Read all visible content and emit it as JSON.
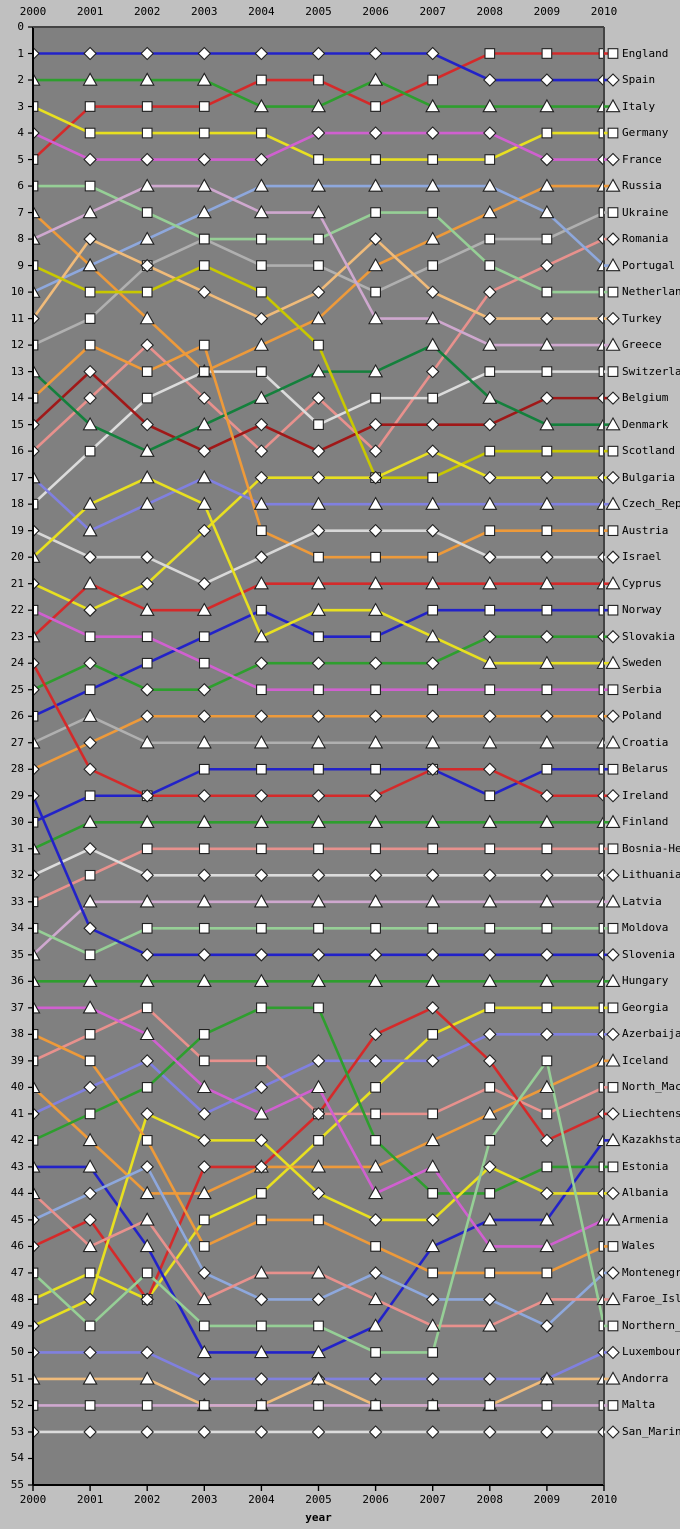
{
  "figure": {
    "background_color": "#c0c0c0",
    "plot_background_color": "#808080",
    "axis_color": "#000000"
  },
  "axes": {
    "x_title": "year",
    "x_ticks": [
      "2000",
      "2001",
      "2002",
      "2003",
      "2004",
      "2005",
      "2006",
      "2007",
      "2008",
      "2009",
      "2010"
    ],
    "x_ticks_top": [
      "2000",
      "2001",
      "2002",
      "2003",
      "2004",
      "2005",
      "2006",
      "2007",
      "2008",
      "2009",
      "2010"
    ],
    "y_ticks": [
      "0",
      "1",
      "2",
      "3",
      "4",
      "5",
      "6",
      "7",
      "8",
      "9",
      "10",
      "11",
      "12",
      "13",
      "14",
      "15",
      "16",
      "17",
      "18",
      "19",
      "20",
      "21",
      "22",
      "23",
      "24",
      "25",
      "26",
      "27",
      "28",
      "29",
      "30",
      "31",
      "32",
      "33",
      "34",
      "35",
      "36",
      "37",
      "38",
      "39",
      "40",
      "41",
      "42",
      "43",
      "44",
      "45",
      "46",
      "47",
      "48",
      "49",
      "50",
      "51",
      "52",
      "53",
      "54",
      "55"
    ]
  },
  "chart_data": {
    "type": "line",
    "subtype": "bump-chart",
    "title": "",
    "xlabel": "year",
    "ylabel": "",
    "x": [
      2000,
      2001,
      2002,
      2003,
      2004,
      2005,
      2006,
      2007,
      2008,
      2009,
      2010
    ],
    "ylim": [
      55,
      0
    ],
    "y_inverted": true,
    "xlim": [
      2000,
      2010
    ],
    "grid": false,
    "legend_position": "right",
    "series": [
      {
        "name": "England",
        "color": "#d42a2a",
        "marker": "square",
        "values": [
          5,
          3,
          3,
          3,
          2,
          2,
          3,
          2,
          1,
          1,
          1
        ]
      },
      {
        "name": "Spain",
        "color": "#2222c8",
        "marker": "diamond",
        "values": [
          1,
          1,
          1,
          1,
          1,
          1,
          1,
          1,
          2,
          2,
          2
        ]
      },
      {
        "name": "Italy",
        "color": "#2e9e2e",
        "marker": "triangle",
        "values": [
          2,
          2,
          2,
          2,
          3,
          3,
          2,
          3,
          3,
          3,
          3
        ]
      },
      {
        "name": "Germany",
        "color": "#e8e020",
        "marker": "square",
        "values": [
          3,
          4,
          4,
          4,
          4,
          5,
          5,
          5,
          5,
          4,
          4
        ]
      },
      {
        "name": "France",
        "color": "#d060d0",
        "marker": "diamond",
        "values": [
          4,
          5,
          5,
          5,
          5,
          4,
          4,
          4,
          4,
          5,
          5
        ]
      },
      {
        "name": "Russia",
        "color": "#ee9a3a",
        "marker": "triangle",
        "values": [
          7,
          9,
          11,
          13,
          12,
          11,
          9,
          8,
          7,
          6,
          6
        ]
      },
      {
        "name": "Ukraine",
        "color": "#b0b0b0",
        "marker": "square",
        "values": [
          12,
          11,
          9,
          8,
          9,
          9,
          10,
          9,
          8,
          8,
          7
        ]
      },
      {
        "name": "Romania",
        "color": "#e8918d",
        "marker": "diamond",
        "values": [
          16,
          14,
          12,
          14,
          16,
          14,
          16,
          13,
          10,
          9,
          8
        ]
      },
      {
        "name": "Portugal",
        "color": "#8ea8dd",
        "marker": "triangle",
        "values": [
          10,
          9,
          8,
          7,
          6,
          6,
          6,
          6,
          6,
          7,
          9
        ]
      },
      {
        "name": "Netherlands",
        "color": "#96cf96",
        "marker": "square",
        "values": [
          6,
          6,
          7,
          8,
          8,
          8,
          7,
          7,
          9,
          10,
          10
        ]
      },
      {
        "name": "Turkey",
        "color": "#f0bb7a",
        "marker": "diamond",
        "values": [
          11,
          8,
          9,
          10,
          11,
          10,
          8,
          10,
          11,
          11,
          11
        ]
      },
      {
        "name": "Greece",
        "color": "#cfa8cf",
        "marker": "triangle",
        "values": [
          8,
          7,
          6,
          6,
          7,
          7,
          11,
          11,
          12,
          12,
          12
        ]
      },
      {
        "name": "Switzerland",
        "color": "#dcdcdc",
        "marker": "square",
        "values": [
          18,
          16,
          14,
          13,
          13,
          15,
          14,
          14,
          13,
          13,
          13
        ]
      },
      {
        "name": "Belgium",
        "color": "#a01818",
        "marker": "diamond",
        "values": [
          15,
          13,
          15,
          16,
          15,
          16,
          15,
          15,
          15,
          14,
          14
        ]
      },
      {
        "name": "Denmark",
        "color": "#14803c",
        "marker": "triangle",
        "values": [
          13,
          15,
          16,
          15,
          14,
          13,
          13,
          12,
          14,
          15,
          15
        ]
      },
      {
        "name": "Scotland",
        "color": "#c8c800",
        "marker": "square",
        "values": [
          9,
          10,
          10,
          9,
          10,
          12,
          17,
          17,
          16,
          16,
          16
        ]
      },
      {
        "name": "Bulgaria",
        "color": "#e8e020",
        "marker": "diamond",
        "values": [
          21,
          22,
          21,
          19,
          17,
          17,
          17,
          16,
          17,
          17,
          17
        ]
      },
      {
        "name": "Czech_Repub",
        "color": "#8080e0",
        "marker": "triangle",
        "values": [
          17,
          19,
          18,
          17,
          18,
          18,
          18,
          18,
          18,
          18,
          18
        ]
      },
      {
        "name": "Austria",
        "color": "#ee9a3a",
        "marker": "square",
        "values": [
          14,
          12,
          13,
          12,
          19,
          20,
          20,
          20,
          19,
          19,
          19
        ]
      },
      {
        "name": "Israel",
        "color": "#d8d8d8",
        "marker": "diamond",
        "values": [
          19,
          20,
          20,
          21,
          20,
          19,
          19,
          19,
          20,
          20,
          20
        ]
      },
      {
        "name": "Cyprus",
        "color": "#d42a2a",
        "marker": "triangle",
        "values": [
          23,
          21,
          22,
          22,
          21,
          21,
          21,
          21,
          21,
          21,
          21
        ]
      },
      {
        "name": "Norway",
        "color": "#2222c8",
        "marker": "square",
        "values": [
          26,
          25,
          24,
          23,
          22,
          23,
          23,
          22,
          22,
          22,
          22
        ]
      },
      {
        "name": "Slovakia",
        "color": "#2e9e2e",
        "marker": "diamond",
        "values": [
          25,
          24,
          25,
          25,
          24,
          24,
          24,
          24,
          23,
          23,
          23
        ]
      },
      {
        "name": "Sweden",
        "color": "#e8e020",
        "marker": "triangle",
        "values": [
          20,
          18,
          17,
          18,
          23,
          22,
          22,
          23,
          24,
          24,
          24
        ]
      },
      {
        "name": "Serbia",
        "color": "#d060d0",
        "marker": "square",
        "values": [
          22,
          23,
          23,
          24,
          25,
          25,
          25,
          25,
          25,
          25,
          25
        ]
      },
      {
        "name": "Poland",
        "color": "#ee9a3a",
        "marker": "diamond",
        "values": [
          28,
          27,
          26,
          26,
          26,
          26,
          26,
          26,
          26,
          26,
          26
        ]
      },
      {
        "name": "Croatia",
        "color": "#b0b0b0",
        "marker": "triangle",
        "values": [
          27,
          26,
          27,
          27,
          27,
          27,
          27,
          27,
          27,
          27,
          27
        ]
      },
      {
        "name": "Belarus",
        "color": "#2222c8",
        "marker": "square",
        "values": [
          30,
          29,
          29,
          28,
          28,
          28,
          28,
          28,
          29,
          28,
          28
        ]
      },
      {
        "name": "Ireland",
        "color": "#d42a2a",
        "marker": "diamond",
        "values": [
          24,
          28,
          29,
          29,
          29,
          29,
          29,
          28,
          28,
          29,
          29
        ]
      },
      {
        "name": "Finland",
        "color": "#2e9e2e",
        "marker": "triangle",
        "values": [
          31,
          30,
          30,
          30,
          30,
          30,
          30,
          30,
          30,
          30,
          30
        ]
      },
      {
        "name": "Bosnia-Herzo",
        "color": "#e8918d",
        "marker": "square",
        "values": [
          33,
          32,
          31,
          31,
          31,
          31,
          31,
          31,
          31,
          31,
          31
        ]
      },
      {
        "name": "Lithuania",
        "color": "#dcdcdc",
        "marker": "diamond",
        "values": [
          32,
          31,
          32,
          32,
          32,
          32,
          32,
          32,
          32,
          32,
          32
        ]
      },
      {
        "name": "Latvia",
        "color": "#cfa8cf",
        "marker": "triangle",
        "values": [
          35,
          33,
          33,
          33,
          33,
          33,
          33,
          33,
          33,
          33,
          33
        ]
      },
      {
        "name": "Moldova",
        "color": "#96cf96",
        "marker": "square",
        "values": [
          34,
          35,
          34,
          34,
          34,
          34,
          34,
          34,
          34,
          34,
          34
        ]
      },
      {
        "name": "Slovenia",
        "color": "#2222c8",
        "marker": "diamond",
        "values": [
          29,
          34,
          35,
          35,
          35,
          35,
          35,
          35,
          35,
          35,
          35
        ]
      },
      {
        "name": "Hungary",
        "color": "#2e9e2e",
        "marker": "triangle",
        "values": [
          36,
          36,
          36,
          36,
          36,
          36,
          36,
          36,
          36,
          36,
          36
        ]
      },
      {
        "name": "Georgia",
        "color": "#e8e020",
        "marker": "square",
        "values": [
          48,
          47,
          48,
          45,
          44,
          42,
          40,
          38,
          37,
          37,
          37
        ]
      },
      {
        "name": "Azerbaijan",
        "color": "#8080e0",
        "marker": "diamond",
        "values": [
          41,
          40,
          39,
          41,
          40,
          39,
          39,
          39,
          38,
          38,
          38
        ]
      },
      {
        "name": "Iceland",
        "color": "#ee9a3a",
        "marker": "triangle",
        "values": [
          40,
          42,
          44,
          44,
          43,
          43,
          43,
          42,
          41,
          40,
          39
        ]
      },
      {
        "name": "North_Macedo",
        "color": "#e8918d",
        "marker": "square",
        "values": [
          39,
          38,
          37,
          39,
          39,
          41,
          41,
          41,
          40,
          41,
          40
        ]
      },
      {
        "name": "Liechtenstei",
        "color": "#d42a2a",
        "marker": "diamond",
        "values": [
          46,
          45,
          48,
          43,
          43,
          41,
          38,
          37,
          39,
          42,
          41
        ]
      },
      {
        "name": "Kazakhstan",
        "color": "#2222c8",
        "marker": "triangle",
        "values": [
          43,
          43,
          46,
          50,
          50,
          50,
          49,
          46,
          45,
          45,
          42
        ]
      },
      {
        "name": "Estonia",
        "color": "#2e9e2e",
        "marker": "square",
        "values": [
          42,
          41,
          40,
          38,
          37,
          37,
          42,
          44,
          44,
          43,
          43
        ]
      },
      {
        "name": "Albania",
        "color": "#e8e020",
        "marker": "diamond",
        "values": [
          49,
          48,
          41,
          42,
          42,
          44,
          45,
          45,
          43,
          44,
          44
        ]
      },
      {
        "name": "Armenia",
        "color": "#d060d0",
        "marker": "triangle",
        "values": [
          37,
          37,
          38,
          40,
          41,
          40,
          44,
          43,
          46,
          46,
          45
        ]
      },
      {
        "name": "Wales",
        "color": "#ee9a3a",
        "marker": "square",
        "values": [
          38,
          39,
          42,
          46,
          45,
          45,
          46,
          47,
          47,
          47,
          46
        ]
      },
      {
        "name": "Montenegro",
        "color": "#8ea8dd",
        "marker": "diamond",
        "values": [
          45,
          44,
          43,
          47,
          48,
          48,
          47,
          48,
          48,
          49,
          47
        ]
      },
      {
        "name": "Faroe_Island",
        "color": "#e8918d",
        "marker": "triangle",
        "values": [
          44,
          46,
          45,
          48,
          47,
          47,
          48,
          49,
          49,
          48,
          48
        ]
      },
      {
        "name": "Northern_Ire",
        "color": "#96cf96",
        "marker": "square",
        "values": [
          47,
          49,
          47,
          49,
          49,
          49,
          50,
          50,
          42,
          39,
          49
        ]
      },
      {
        "name": "Luxembourg",
        "color": "#8080e0",
        "marker": "diamond",
        "values": [
          50,
          50,
          50,
          51,
          51,
          51,
          51,
          51,
          51,
          51,
          50
        ]
      },
      {
        "name": "Andorra",
        "color": "#f0bb7a",
        "marker": "triangle",
        "values": [
          51,
          51,
          51,
          52,
          52,
          51,
          52,
          52,
          52,
          51,
          51
        ]
      },
      {
        "name": "Malta",
        "color": "#cfa8cf",
        "marker": "square",
        "values": [
          52,
          52,
          52,
          52,
          52,
          52,
          52,
          52,
          52,
          52,
          52
        ]
      },
      {
        "name": "San_Marino",
        "color": "#dcdcdc",
        "marker": "diamond",
        "values": [
          53,
          53,
          53,
          53,
          53,
          53,
          53,
          53,
          53,
          53,
          53
        ]
      }
    ]
  }
}
